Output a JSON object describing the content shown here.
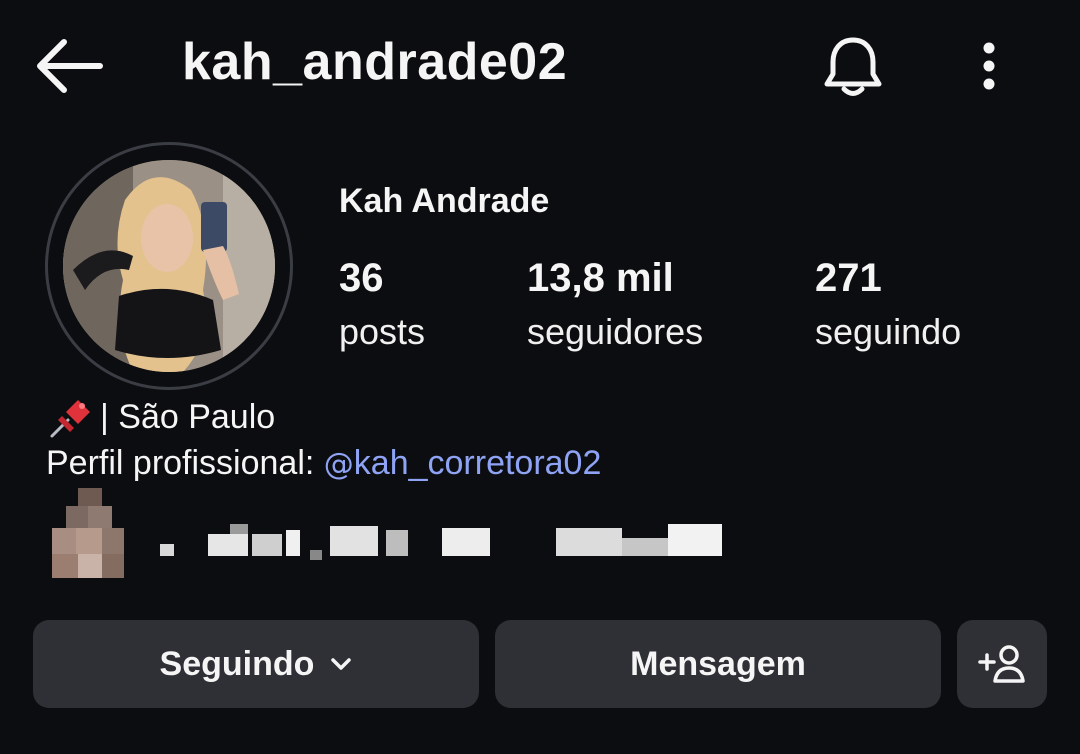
{
  "header": {
    "username": "kah_andrade02",
    "back_icon": "arrow-left-icon",
    "notifications_icon": "bell-icon",
    "more_icon": "more-vertical-icon"
  },
  "profile": {
    "display_name": "Kah Andrade",
    "stats": [
      {
        "value": "36",
        "label": "posts"
      },
      {
        "value": "13,8 mil",
        "label": "seguidores"
      },
      {
        "value": "271",
        "label": "seguindo"
      }
    ]
  },
  "bio": {
    "pin_icon": "pushpin-icon",
    "location_line": "| São Paulo",
    "professional_prefix": "Perfil profissional: ",
    "threads_glyph": "@",
    "threads_handle": "kah_corretora02"
  },
  "actions": {
    "following_label": "Seguindo",
    "message_label": "Mensagem",
    "add_user_icon": "add-user-icon"
  },
  "colors": {
    "background": "#0c0d10",
    "button_bg": "#2e3036",
    "link": "#8fa3f5"
  }
}
